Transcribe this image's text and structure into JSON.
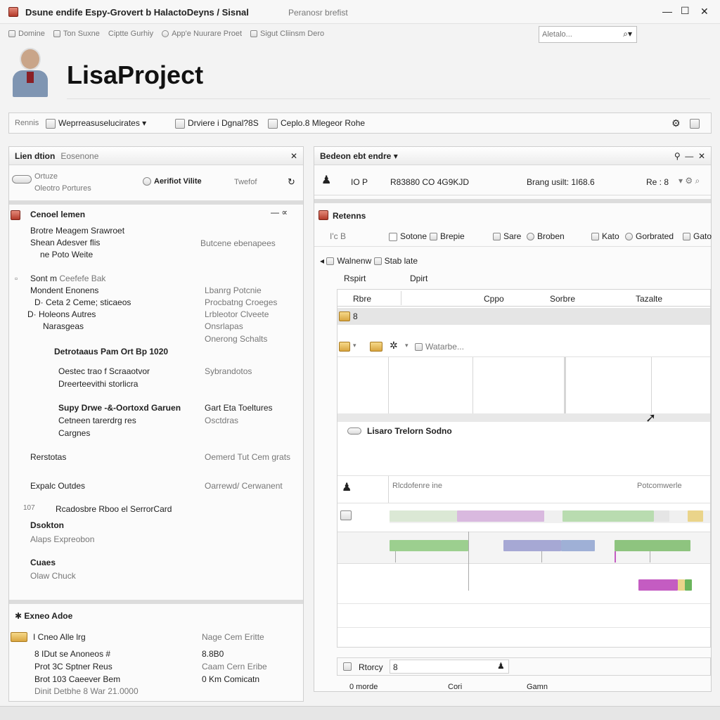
{
  "window": {
    "title": "Dsune endife Espy-Grovert b HalactoDeyns / Sisnal",
    "title_extra": "Peranosr brefist",
    "controls": {
      "minimize": "—",
      "maximize": "☐",
      "close": "✕"
    }
  },
  "menubar": {
    "items": [
      "Domine",
      "Ton Suxne",
      "Ciptte Gurhiy",
      "App'e Nuurare Proet",
      "Sigut Cliinsm Dero"
    ],
    "search_placeholder": "Aletalo..."
  },
  "brand": {
    "name": "LisaProject"
  },
  "toolbar": {
    "label": "Rennis",
    "item1": "Weprreasuselucirates",
    "item2": "Drviere i Dgnal?8S",
    "item3": "Ceplo.8 Mlegeor Rohe"
  },
  "left_panel": {
    "title": "Lien dtion",
    "title_muted": "Eosenone",
    "close": "✕",
    "sub_left_1": "Ortuze",
    "sub_left_2": "Oleotro Portures",
    "sub_mid": "Aerifiot Vilite",
    "sub_right": "Twefof",
    "section1": {
      "title": "Cenoel lemen",
      "lines": [
        "Brotre Meagem Srawroet",
        "Shean Adesver flis",
        "ne Poto Weite"
      ],
      "right": "Butcene ebenapees"
    },
    "tree": [
      {
        "left": "Sont m",
        "left_muted": "Ceefefe Bak",
        "right": ""
      },
      {
        "left": "Mondent Enonens",
        "right": "Lbanrg Potcnie"
      },
      {
        "left": "D· Ceta 2 Ceme; sticaeos",
        "right": "Procbatng Croeges"
      },
      {
        "left": "D· Holeons Autres",
        "right": "Lrbleotor Clveete"
      },
      {
        "left": "Narasgeas",
        "right": "Onsrlapas"
      },
      {
        "left": "",
        "right": "Onerong Schalts"
      }
    ],
    "group1": {
      "title": "Detrotaaus Pam Ort Bp 1020",
      "lines": [
        "Oestec trao f Scraaotvor",
        "Dreerteevithi storlicra"
      ],
      "right": "Sybrandotos"
    },
    "group2": {
      "title": "Supy Drwe -&-Oortoxd Garuen",
      "lines": [
        "Cetneen tarerdrg res",
        "Cargnes"
      ],
      "right_title": "Gart  Eta Toeltures",
      "right": "Osctdras"
    },
    "rows": [
      {
        "left": "Rerstotas",
        "right": "Oemerd Tut Cem grats"
      },
      {
        "left": "Expalc Outdes",
        "right": "Oarrewd/ Cerwanent"
      },
      {
        "left": "Rcadosbre Rboo el SerrorCard",
        "left_muted": "107"
      },
      {
        "left": "Dsokton",
        "right": ""
      },
      {
        "left": "Alaps Expreobon",
        "right": ""
      },
      {
        "left": "Cuaes",
        "right": ""
      },
      {
        "left": "Olaw Chuck",
        "right": ""
      }
    ],
    "footer": {
      "title": "Exneo Adoe",
      "label_left": "I Cneo Alle lrg",
      "label_right": "Nage Cem Eritte",
      "rows": [
        {
          "left": "8 IDut se Anoneos #",
          "right": "8.8B0"
        },
        {
          "left": "Prot 3C Sptner Reus",
          "right": "Caam Cern Eribe"
        },
        {
          "left": "Brot 103 Caeever Bem",
          "right": "0 Km Comicatn"
        },
        {
          "left": "Dinit Detbhe 8 War 21.0000",
          "right": ""
        }
      ]
    }
  },
  "right_panel": {
    "title": "Bedeon ebt endre",
    "info": {
      "io": "IO P",
      "code": "R83880 CO 4G9KJD",
      "status": "Brang usilt: 1I68.6",
      "re": "Re : 8"
    },
    "retems": {
      "title": "Retenns",
      "tb_left": "I'c B",
      "tb": [
        "Sotone",
        "Brepie",
        "Sare",
        "Broben",
        "Kato",
        "Gorbrated",
        "Gato"
      ],
      "breadcrumb": "Walnenw",
      "breadcrumb2": "Stab late",
      "fields": [
        "Rspirt",
        "Dpirt"
      ],
      "columns": [
        "Rbre",
        "Cppo",
        "Sorbre",
        "Tazalte"
      ],
      "row_label": "8",
      "row2_label": "Watarbe..."
    },
    "section": {
      "title": "Lisaro Trelorn Sodno",
      "left": "Rlcdofenre ine",
      "right": "Potcomwerle"
    },
    "bottom": {
      "label": "Rtorcy",
      "value": "8",
      "cols": [
        "0 morde",
        "Cori",
        "Gamn"
      ]
    }
  },
  "gantt": {
    "colors": {
      "green": "#9ccf8f",
      "purple": "#cfa1d8",
      "blue": "#9fb0d6",
      "yellow": "#ead48a",
      "magenta": "#c45cc2",
      "light_green": "#c5e3bd"
    }
  }
}
